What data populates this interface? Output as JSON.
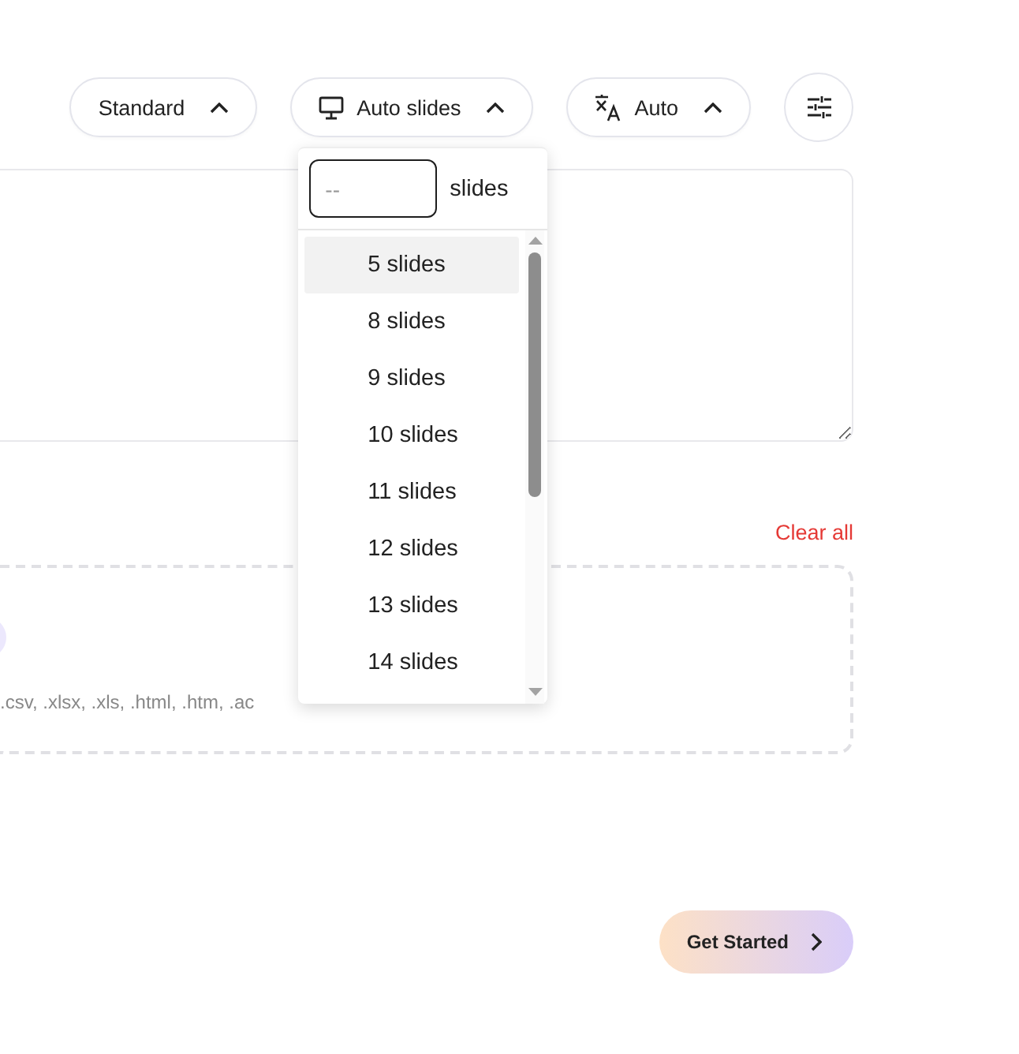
{
  "toolbar": {
    "pills": [
      {
        "kind": "plain",
        "label": "Standard"
      },
      {
        "kind": "slides",
        "label": "Auto slides"
      },
      {
        "kind": "language",
        "label": "Auto"
      }
    ]
  },
  "slide_count_menu": {
    "input": {
      "placeholder": "--"
    },
    "unit": "slides",
    "options": [
      {
        "label": "5 slides",
        "selected": true
      },
      {
        "label": "8 slides",
        "selected": false
      },
      {
        "label": "9 slides",
        "selected": false
      },
      {
        "label": "10 slides",
        "selected": false
      },
      {
        "label": "11 slides",
        "selected": false
      },
      {
        "label": "12 slides",
        "selected": false
      },
      {
        "label": "13 slides",
        "selected": false
      },
      {
        "label": "14 slides",
        "selected": false
      }
    ]
  },
  "attachments": {
    "clear_label": "Clear all",
    "formats": ".csv, .xlsx, .xls, .html, .htm, .ac"
  },
  "actions": {
    "primary": "Get Started"
  }
}
